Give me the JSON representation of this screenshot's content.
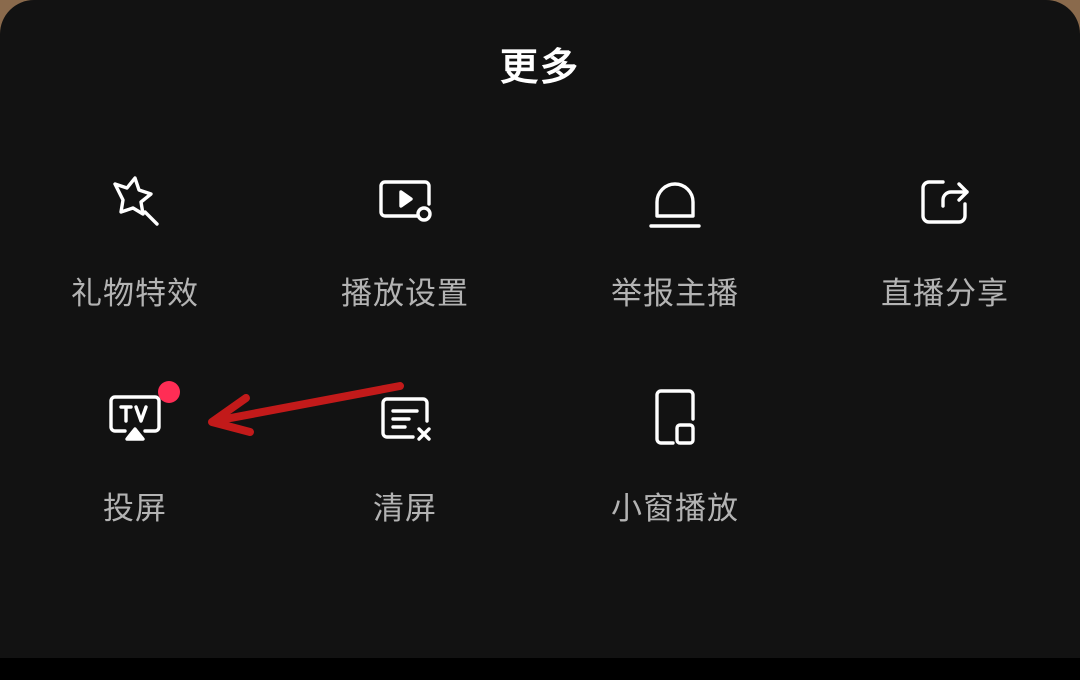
{
  "sheet": {
    "title": "更多"
  },
  "items": [
    {
      "label": "礼物特效",
      "icon": "gift-effect-icon"
    },
    {
      "label": "播放设置",
      "icon": "play-settings-icon"
    },
    {
      "label": "举报主播",
      "icon": "report-siren-icon"
    },
    {
      "label": "直播分享",
      "icon": "share-icon"
    },
    {
      "label": "投屏",
      "icon": "tv-cast-icon"
    },
    {
      "label": "清屏",
      "icon": "clear-screen-icon"
    },
    {
      "label": "小窗播放",
      "icon": "mini-window-icon"
    }
  ],
  "colors": {
    "sheet_bg": "#121212",
    "label": "#b3b3b3",
    "title": "#ffffff",
    "badge": "#ff2d55",
    "annotation_arrow": "#c21a1a"
  }
}
